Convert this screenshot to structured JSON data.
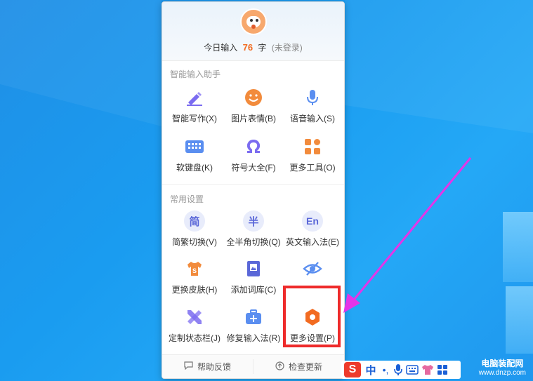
{
  "header": {
    "today_prefix": "今日输入",
    "today_count": "76",
    "today_unit": "字",
    "login_status": "(未登录)"
  },
  "sections": {
    "smart": {
      "title": "智能输入助手",
      "items": [
        {
          "label": "智能写作(X)",
          "icon": "pen-icon"
        },
        {
          "label": "图片表情(B)",
          "icon": "smile-icon"
        },
        {
          "label": "语音输入(S)",
          "icon": "microphone-icon"
        },
        {
          "label": "软键盘(K)",
          "icon": "keyboard-icon"
        },
        {
          "label": "符号大全(F)",
          "icon": "omega-icon"
        },
        {
          "label": "更多工具(O)",
          "icon": "grid-icon"
        }
      ]
    },
    "common": {
      "title": "常用设置",
      "items": [
        {
          "label": "简繁切换(V)",
          "glyph": "简",
          "icon": "simplified-traditional-icon"
        },
        {
          "label": "全半角切换(Q)",
          "glyph": "半",
          "icon": "half-width-icon"
        },
        {
          "label": "英文输入法(E)",
          "glyph": "En",
          "icon": "english-icon"
        },
        {
          "label": "更换皮肤(H)",
          "icon": "shirt-icon"
        },
        {
          "label": "添加词库(C)",
          "icon": "book-icon"
        },
        {
          "label": "",
          "icon": "eye-off-icon"
        },
        {
          "label": "定制状态栏(J)",
          "icon": "ruler-pencil-icon"
        },
        {
          "label": "修复输入法(R)",
          "icon": "toolbox-icon"
        },
        {
          "label": "更多设置(P)",
          "icon": "hexagon-gear-icon"
        }
      ]
    }
  },
  "footer": {
    "help_label": "帮助反馈",
    "update_label": "检查更新"
  },
  "imebar": {
    "logo": "S",
    "mode": "中",
    "punct": "•,"
  },
  "watermark": {
    "line1": "电脑装配网",
    "line2": "www.dnzp.com"
  },
  "colors": {
    "accent": "#f26b21",
    "icon_purple": "#7b6cf0",
    "icon_blue": "#5a8ef0",
    "icon_orange": "#f28b3c",
    "highlight_box": "#ee2b2b",
    "arrow": "#e534e8"
  }
}
